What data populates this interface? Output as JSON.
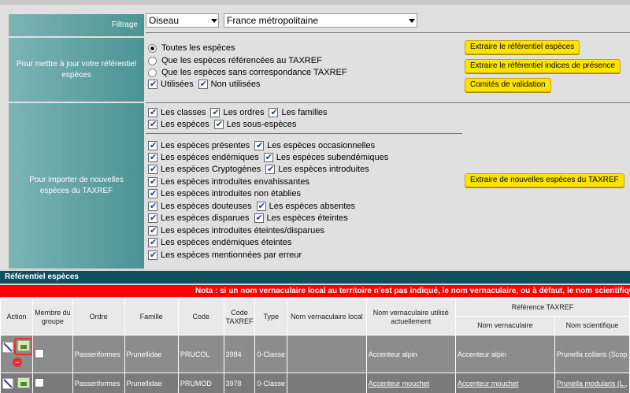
{
  "filters": {
    "label": "Filtrage",
    "group_value": "Oiseau",
    "territory_value": "France métropolitaine"
  },
  "update": {
    "label": "Pour mettre à jour votre référentiel espèces",
    "radios": [
      {
        "label": "Toutes les espèces",
        "checked": true
      },
      {
        "label": "Que les espèces référencées au TAXREF",
        "checked": false
      },
      {
        "label": "Que les espèces sans correspondance TAXREF",
        "checked": false
      }
    ],
    "checks": [
      {
        "label": "Utilisées",
        "checked": true
      },
      {
        "label": "Non utilisées",
        "checked": true
      }
    ],
    "buttons": {
      "extract_species": "Extraire le référentiel espèces",
      "extract_presence": "Extraire le référentiel indices de présence",
      "validation": "Comités de validation"
    }
  },
  "import": {
    "label": "Pour importer de nouvelles espèces du TAXREF",
    "ranks": [
      {
        "label": "Les classes",
        "checked": true
      },
      {
        "label": "Les ordres",
        "checked": true
      },
      {
        "label": "Les familles",
        "checked": true
      },
      {
        "label": "Les espèces",
        "checked": true
      },
      {
        "label": "Les sous-espèces",
        "checked": true
      }
    ],
    "statuses": [
      {
        "label": "Les espèces présentes",
        "checked": true
      },
      {
        "label": "Les espèces occasionnelles",
        "checked": true
      },
      {
        "label": "Les espèces endémiques",
        "checked": true
      },
      {
        "label": "Les espèces subendémiques",
        "checked": true
      },
      {
        "label": "Les espèces Cryptogènes",
        "checked": true
      },
      {
        "label": "Les espèces introduites",
        "checked": true
      },
      {
        "label": "Les espèces introduites envahissantes",
        "checked": true
      },
      {
        "label": "Les espèces introduites non établies",
        "checked": true
      },
      {
        "label": "Les espèces douteuses",
        "checked": true
      },
      {
        "label": "Les espèces absentes",
        "checked": true
      },
      {
        "label": "Les espèces disparues",
        "checked": true
      },
      {
        "label": "Les espèces éteintes",
        "checked": true
      },
      {
        "label": "Les espèces introduites éteintes/disparues",
        "checked": true
      },
      {
        "label": "Les espèces endémiques éteintes",
        "checked": true
      },
      {
        "label": "Les espèces mentionnées par erreur",
        "checked": true
      }
    ],
    "button": "Extraire de nouvelles espèces du TAXREF"
  },
  "referential": {
    "title": "Référentiel espèces",
    "nota": "Nota : si un nom vernaculaire local au territoire n'est pas indiqué, le nom vernaculaire, ou à défaut, le nom scientifique du",
    "headers": {
      "action": "Action",
      "member": "Membre du groupe",
      "order": "Ordre",
      "family": "Famille",
      "code": "Code",
      "taxref_code": "Code TAXREF",
      "type": "Type",
      "local_name": "Nom vernaculaire local",
      "used_name": "Nom vernaculaire utilisé actuellement",
      "taxref_ref": "Référence TAXREF",
      "vern_name": "Nom vernaculaire",
      "sci_name": "Nom scientifique"
    },
    "rows": [
      {
        "order": "Passeriformes",
        "family": "Prunellidae",
        "code": "PRUCOL",
        "taxref": "3984",
        "type": "0-Classe",
        "local": "",
        "used": "Accenteur alpin",
        "vern": "Accenteur alpin",
        "sci": "Prunella collaris (Scop"
      },
      {
        "order": "Passeriformes",
        "family": "Prunellidae",
        "code": "PRUMOD",
        "taxref": "3978",
        "type": "0-Classe",
        "local": "",
        "used": "Accenteur mouchet",
        "vern": "Accenteur mouchet",
        "sci": "Prunella modularis (L.,"
      }
    ]
  }
}
